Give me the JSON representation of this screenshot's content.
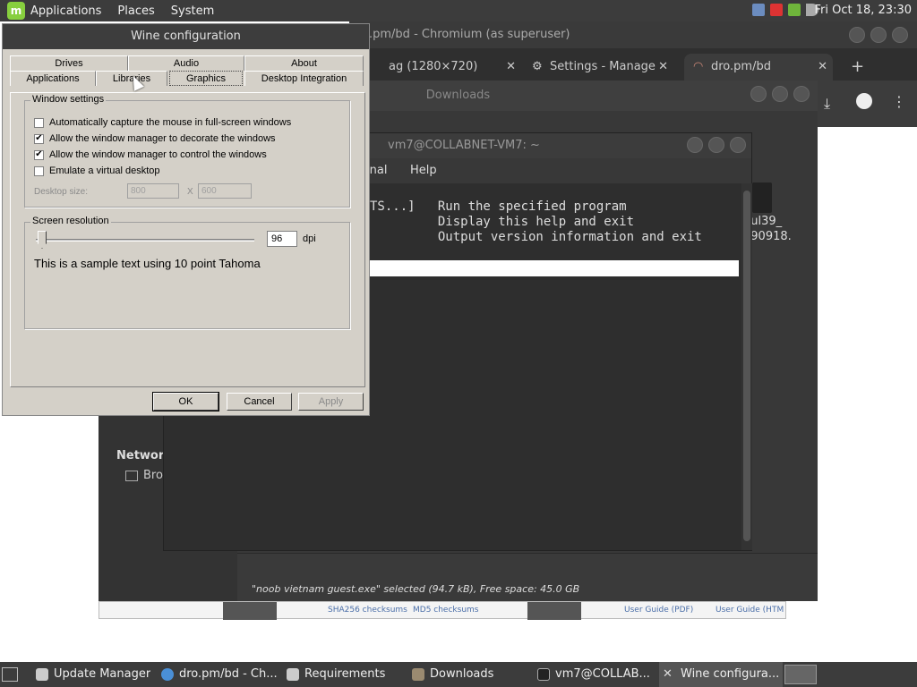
{
  "top_panel": {
    "menus": [
      "Applications",
      "Places",
      "System"
    ],
    "clock": "Fri Oct 18, 23:30"
  },
  "chromium": {
    "title": "dro.pm/bd - Chromium (as superuser)",
    "title_visible": ".pm/bd - Chromium (as superuser)",
    "tabs": [
      {
        "label": "ag (1280×720)"
      },
      {
        "label": "Settings - Manage"
      },
      {
        "label": "dro.pm/bd"
      }
    ],
    "new_tab": "+"
  },
  "downloads": {
    "title": "Downloads",
    "sidebar_network": "Network",
    "sidebar_network_item": "Bro",
    "status": "\"noob vietnam guest.exe\" selected (94.7 kB), Free space: 45.0 GB"
  },
  "page_strip": {
    "link1": "SHA256 checksums",
    "link2": "MD5 checksums",
    "link3": "User Guide (PDF)",
    "link4": "User Guide (HTM"
  },
  "file_fragments": [
    "dul39_",
    "090918."
  ],
  "terminal": {
    "title": "vm7@COLLABNET-VM7: ~",
    "menu_terminal": "inal",
    "menu_help": "Help",
    "lines": [
      "TS...]   Run the specified program",
      "         Display this help and exit",
      "         Output version information and exit"
    ]
  },
  "wine": {
    "title": "Wine configuration",
    "tabs_row1": [
      "Drives",
      "Audio",
      "About"
    ],
    "tabs_row2": [
      "Applications",
      "Libraries",
      "Graphics",
      "Desktop Integration"
    ],
    "window_settings": {
      "legend": "Window settings",
      "options": [
        {
          "label": "Automatically capture the mouse in full-screen windows",
          "checked": false
        },
        {
          "label": "Allow the window manager to decorate the windows",
          "checked": true
        },
        {
          "label": "Allow the window manager to control the windows",
          "checked": true
        },
        {
          "label": "Emulate a virtual desktop",
          "checked": false
        }
      ],
      "desktop_size_label": "Desktop size:",
      "width": "800",
      "x_label": "X",
      "height": "600"
    },
    "screen_resolution": {
      "legend": "Screen resolution",
      "dpi_value": "96",
      "dpi_unit": "dpi",
      "sample_text": "This is a sample text using 10 point Tahoma"
    },
    "buttons": {
      "ok": "OK",
      "cancel": "Cancel",
      "apply": "Apply"
    }
  },
  "taskbar": {
    "items": [
      {
        "label": "Update Manager"
      },
      {
        "label": "dro.pm/bd - Ch..."
      },
      {
        "label": "Requirements"
      },
      {
        "label": "Downloads"
      },
      {
        "label": "vm7@COLLAB..."
      },
      {
        "label": "Wine configura..."
      }
    ]
  },
  "colors": {
    "panel": "#3c3c3c",
    "wine_face": "#d4d0c8",
    "mint_green": "#87cf3e"
  }
}
